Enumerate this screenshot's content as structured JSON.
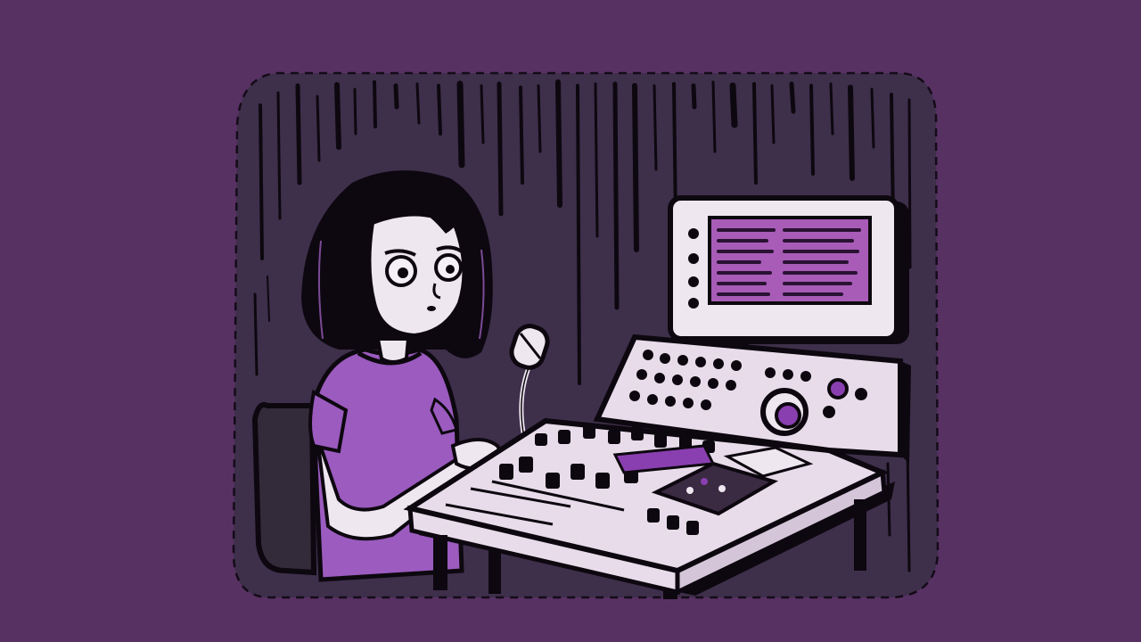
{
  "scene": {
    "description_tags": [
      "illustration",
      "girl",
      "audio-mixer",
      "microphone",
      "monitor",
      "chair",
      "dripping-wall"
    ],
    "colors": {
      "background": "#583163",
      "panel": "#3e2f4b",
      "ink": "#0d080f",
      "shirt": "#9b5bbf",
      "skin": "#efe7f0",
      "desk": "#e8dcea",
      "screen": "#a85cb8",
      "accent": "#8a3fb0"
    }
  }
}
